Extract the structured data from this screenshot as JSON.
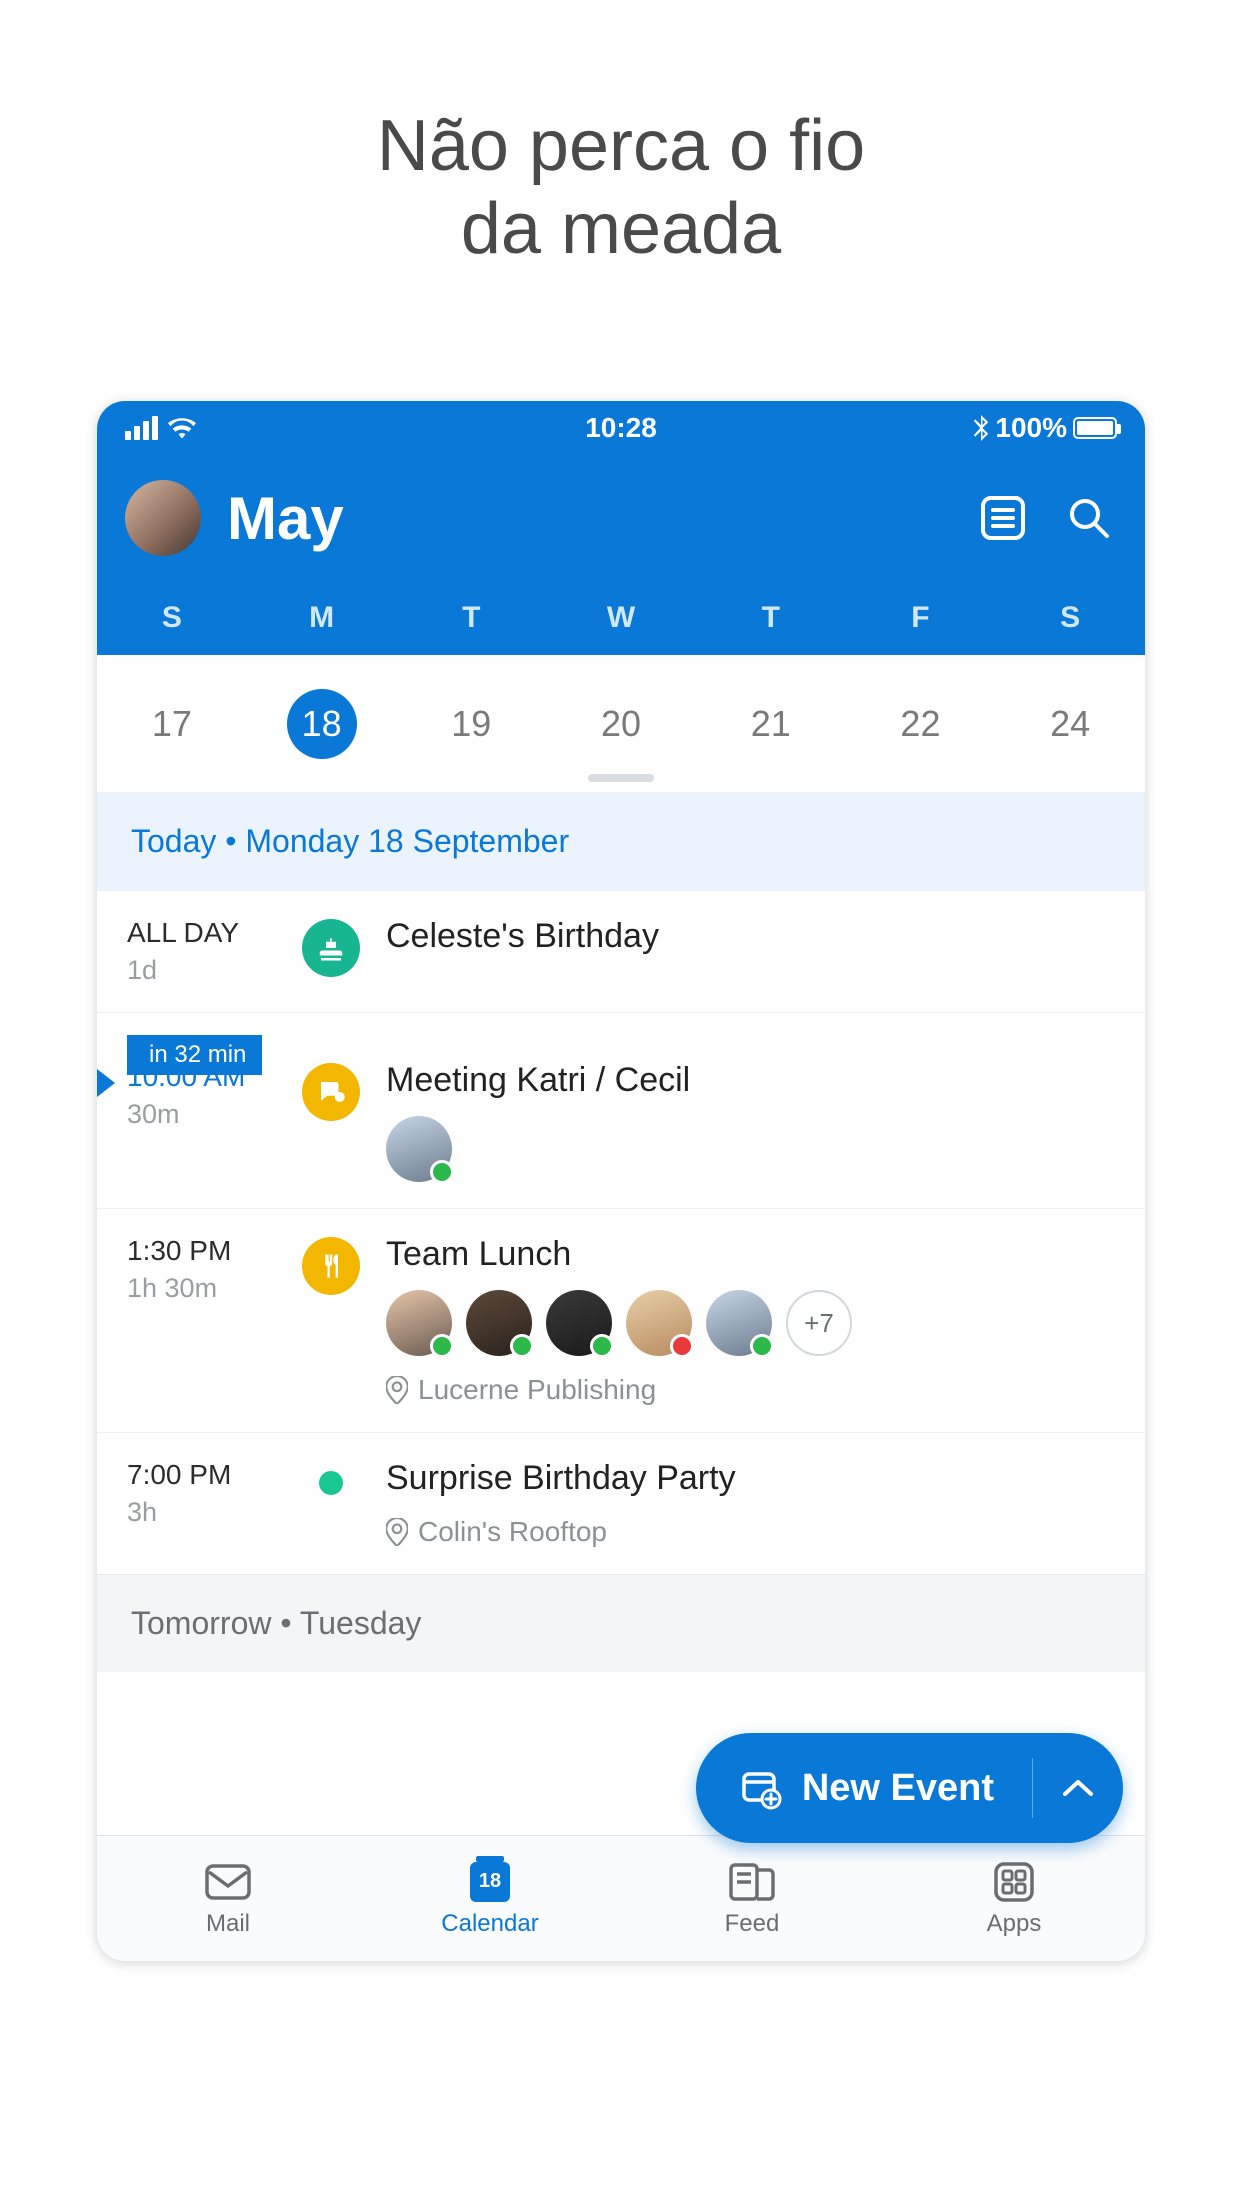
{
  "marketing_headline_line1": "Não perca o fio",
  "marketing_headline_line2": "da meada",
  "status": {
    "time": "10:28",
    "battery": "100%"
  },
  "header": {
    "month": "May"
  },
  "weekdays": [
    "S",
    "M",
    "T",
    "W",
    "T",
    "F",
    "S"
  ],
  "dates": [
    "17",
    "18",
    "19",
    "20",
    "21",
    "22",
    "24"
  ],
  "selected_date_index": 1,
  "sections": {
    "today_label": "Today • Monday 18 September",
    "tomorrow_label": "Tomorrow • Tuesday"
  },
  "events": {
    "e0": {
      "time_label": "ALL DAY",
      "duration": "1d",
      "title": "Celeste's Birthday"
    },
    "e1": {
      "countdown": "in 32 min",
      "time_label": "10:00 AM",
      "duration": "30m",
      "title": "Meeting Katri / Cecil"
    },
    "e2": {
      "time_label": "1:30 PM",
      "duration": "1h 30m",
      "title": "Team Lunch",
      "location": "Lucerne Publishing",
      "more_attendees": "+7"
    },
    "e3": {
      "time_label": "7:00 PM",
      "duration": "3h",
      "title": "Surprise Birthday Party",
      "location": "Colin's Rooftop"
    }
  },
  "fab": {
    "label": "New Event"
  },
  "tabs": {
    "mail": "Mail",
    "calendar": "Calendar",
    "calendar_day": "18",
    "feed": "Feed",
    "apps": "Apps"
  }
}
